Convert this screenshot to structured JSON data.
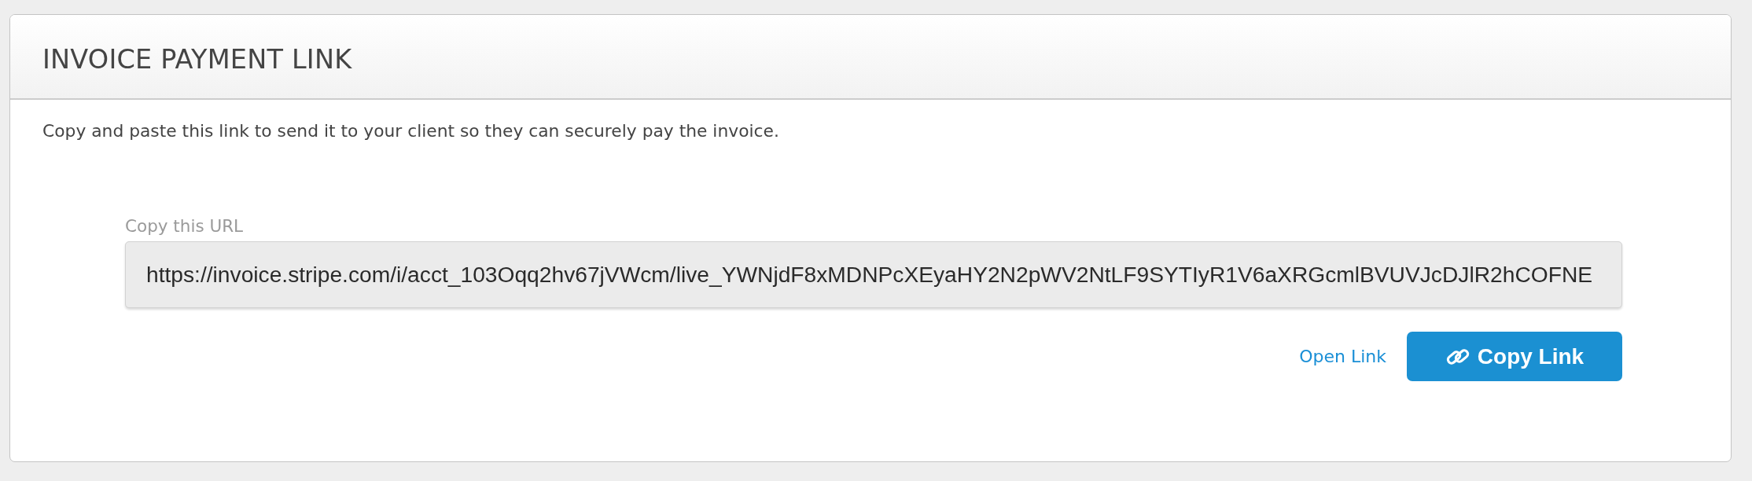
{
  "panel": {
    "title": "INVOICE PAYMENT LINK",
    "description": "Copy and paste this link to send it to your client so they can securely pay the invoice.",
    "url_field": {
      "label": "Copy this URL",
      "value": "https://invoice.stripe.com/i/acct_103Oqq2hv67jVWcm/live_YWNjdF8xMDNPcXEyaHY2N2pWV2NtLF9SYTIyR1V6aXRGcmlBVUVJcDJlR2hCOFNE"
    },
    "actions": [
      {
        "kind": "link",
        "label": "Open Link"
      },
      {
        "kind": "button",
        "label": "Copy Link"
      }
    ]
  }
}
